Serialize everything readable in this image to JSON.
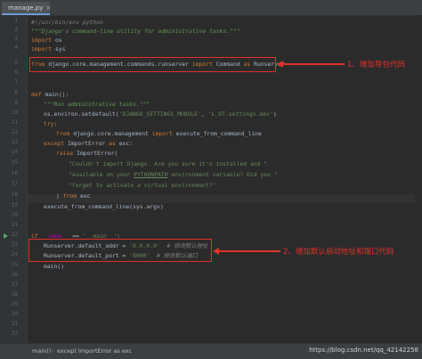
{
  "tab": {
    "label": "manage.py",
    "close": "×"
  },
  "code_lines": [
    {
      "num": "1",
      "html_key": "l1"
    },
    {
      "num": "2",
      "html_key": "l2"
    },
    {
      "num": "3",
      "html_key": "l3"
    },
    {
      "num": "4",
      "html_key": "l4"
    },
    {
      "num": "5",
      "html_key": "l5"
    },
    {
      "num": "6",
      "html_key": "l6"
    },
    {
      "num": "7",
      "html_key": "l7"
    },
    {
      "num": "8",
      "html_key": "l8"
    },
    {
      "num": "9",
      "html_key": "l9"
    },
    {
      "num": "10",
      "html_key": "l10"
    },
    {
      "num": "11",
      "html_key": "l11"
    },
    {
      "num": "12",
      "html_key": "l12"
    },
    {
      "num": "13",
      "html_key": "l13"
    },
    {
      "num": "14",
      "html_key": "l14"
    },
    {
      "num": "15",
      "html_key": "l15"
    },
    {
      "num": "16",
      "html_key": "l16"
    },
    {
      "num": "17",
      "html_key": "l17"
    },
    {
      "num": "18",
      "html_key": "l18"
    },
    {
      "num": "19",
      "html_key": "l19"
    },
    {
      "num": "20",
      "html_key": "l20"
    },
    {
      "num": "21",
      "html_key": "l21"
    },
    {
      "num": "22",
      "html_key": "l22"
    },
    {
      "num": "23",
      "html_key": "l23"
    },
    {
      "num": "24",
      "html_key": "l24"
    },
    {
      "num": "25",
      "html_key": "l25"
    },
    {
      "num": "26",
      "html_key": "l26"
    },
    {
      "num": "27",
      "html_key": "l27"
    },
    {
      "num": "28",
      "html_key": "l28"
    },
    {
      "num": "29",
      "html_key": "l29"
    },
    {
      "num": "30",
      "html_key": "l30"
    },
    {
      "num": "31",
      "html_key": "l31"
    },
    {
      "num": "32",
      "html_key": "l32"
    },
    {
      "num": "33",
      "html_key": "l33"
    },
    {
      "num": "34",
      "html_key": "l34"
    },
    {
      "num": "35",
      "html_key": "l35"
    },
    {
      "num": "36",
      "html_key": "l36"
    }
  ],
  "code": {
    "l1": "#!/usr/bin/env python",
    "l2": "\"\"\"Django's command-line utility for administrative tasks.\"\"\"",
    "l3_kw": "import",
    "l3_rest": " os",
    "l4_kw": "import",
    "l4_rest": " sys",
    "l5_kw1": "from",
    "l5_mid": " django.core.management.commands.runserver ",
    "l5_kw2": "import",
    "l5_rest": " Command ",
    "l5_kw3": "as",
    "l5_end": " Runserver",
    "l8_kw": "def",
    "l8_rest": " main():",
    "l9": "\"\"\"Run administrative tasks.\"\"\"",
    "l10_pre": "os.environ.setdefault(",
    "l10_s1": "'DJANGO_SETTINGS_MODULE'",
    "l10_mid": ", ",
    "l10_s2": "'L_DT.settings.dev'",
    "l10_end": ")",
    "l11_kw": "try",
    "l11_rest": ":",
    "l12_kw1": "from",
    "l12_mid": " django.core.management ",
    "l12_kw2": "import",
    "l12_rest": " execute_from_command_line",
    "l13_kw1": "except",
    "l13_mid": " ImportError ",
    "l13_kw2": "as",
    "l13_rest": " exc:",
    "l14_kw": "raise",
    "l14_rest": " ImportError(",
    "l15": "\"Couldn't import Django. Are you sure it's installed and \"",
    "l16_pre": "\"available on your ",
    "l16_u": "PYTHONPATH",
    "l16_post": " environment variable? Did you \"",
    "l17": "\"forget to activate a virtual environment?\"",
    "l18_pre": ") ",
    "l18_kw": "from",
    "l18_rest": " exc",
    "l19": "execute_from_command_line(sys.argv)",
    "l22_kw": "if",
    "l22_d1": " __name__",
    "l22_mid": " == ",
    "l22_s": "'__main__'",
    "l22_end": ":",
    "l23_pre": "Runserver.default_addr = ",
    "l23_s": "'0.0.0.0'",
    "l23_c": "  # 修改默认地址",
    "l24_pre": "Runserver.default_port = ",
    "l24_s": "'8000'",
    "l24_c": "  # 修改默认端口",
    "l25": "main()"
  },
  "annotations": {
    "note1": "1、增加导包代码",
    "note2": "2、增加默认启动地址和端口代码"
  },
  "statusbar": {
    "crumb1": "main()",
    "crumb2": "except ImportError as exc",
    "watermark": "https://blog.csdn.net/qq_42142258"
  },
  "colors": {
    "background": "#2b2b2b",
    "keyword": "#cc7832",
    "string": "#6a8759",
    "docstring": "#629755",
    "annotation": "#e0322a"
  }
}
